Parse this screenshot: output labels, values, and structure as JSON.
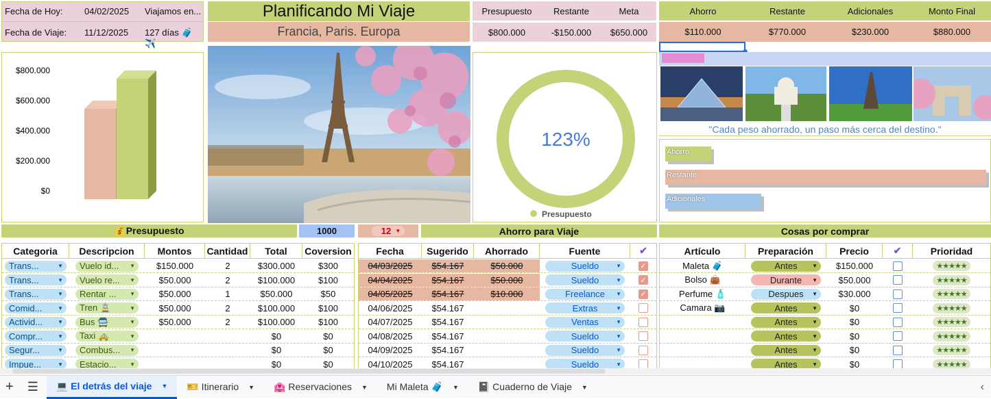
{
  "header": {
    "fecha_hoy_label": "Fecha de Hoy:",
    "fecha_hoy": "04/02/2025",
    "viajamos_label": "Viajamos en...",
    "fecha_viaje_label": "Fecha de Viaje:",
    "fecha_viaje": "11/12/2025",
    "dias": "127 días 🧳 ✈️",
    "title": "Planificando Mi Viaje",
    "destination": "Francia, Paris. Europa"
  },
  "budget_summary": {
    "headers": [
      "Presupuesto",
      "Restante",
      "Meta"
    ],
    "values": [
      "$800.000",
      "-$150.000",
      "$650.000"
    ]
  },
  "savings_summary": {
    "headers": [
      "Ahorro",
      "Restante",
      "Adicionales",
      "Monto Final"
    ],
    "values": [
      "$110.000",
      "$770.000",
      "$230.000",
      "$880.000"
    ]
  },
  "bar_chart": {
    "ticks": [
      "$800.000",
      "$600.000",
      "$400.000",
      "$200.000",
      "$0"
    ],
    "colors": {
      "a": "#e6b8a2",
      "b": "#c6d278"
    }
  },
  "chart_data": [
    {
      "type": "bar",
      "categories": [
        ""
      ],
      "series": [
        {
          "values": [
            600000
          ]
        },
        {
          "values": [
            800000
          ]
        }
      ],
      "ylim": [
        0,
        800000
      ],
      "yticks": [
        "$800.000",
        "$600.000",
        "$400.000",
        "$200.000",
        "$0"
      ],
      "grid": false
    },
    {
      "type": "pie",
      "value_label": "123%",
      "legend": "Presupuesto",
      "color": "#c6d278",
      "values": [
        100
      ]
    },
    {
      "type": "bar",
      "orientation": "horizontal",
      "categories": [
        "Ahorro",
        "Restante",
        "Adicionales"
      ],
      "values": [
        110000,
        770000,
        230000
      ],
      "colors": [
        "#c6d278",
        "#e6b8a2",
        "#9fc5e8"
      ],
      "xlim": [
        0,
        770000
      ]
    }
  ],
  "donut": {
    "percent": "123%",
    "legend": "Presupuesto",
    "color": "#c6d278"
  },
  "quote": "\"Cada peso ahorrado, un paso más cerca del destino.\"",
  "hbars": {
    "labels": [
      "Ahorro",
      "Restante",
      "Adicionales"
    ]
  },
  "section_titles": {
    "presupuesto": "💰Presupuesto",
    "presupuesto_val": "1000",
    "ahorro_count": "12",
    "ahorro": "Ahorro para Viaje",
    "cosas": "Cosas por comprar"
  },
  "budget_table": {
    "headers": [
      "Categoria",
      "Descripcion",
      "Montos",
      "Cantidad",
      "Total",
      "Coversion"
    ],
    "rows": [
      [
        "Trans...",
        "Vuelo id...",
        "$150.000",
        "2",
        "$300.000",
        "$300"
      ],
      [
        "Trans...",
        "Vuelo re...",
        "$50.000",
        "2",
        "$100.000",
        "$100"
      ],
      [
        "Trans...",
        "Rentar ...",
        "$50.000",
        "1",
        "$50.000",
        "$50"
      ],
      [
        "Comid...",
        "Tren 🚊",
        "$50.000",
        "2",
        "$100.000",
        "$100"
      ],
      [
        "Activid...",
        "Bus 🚍",
        "$50.000",
        "2",
        "$100.000",
        "$100"
      ],
      [
        "Compr...",
        "Taxi 🚕",
        "",
        "",
        "$0",
        "$0"
      ],
      [
        "Segur...",
        "Combus...",
        "",
        "",
        "$0",
        "$0"
      ],
      [
        "Impue...",
        "Estacio...",
        "",
        "",
        "$0",
        "$0"
      ]
    ]
  },
  "savings_table": {
    "headers": [
      "Fecha",
      "Sugerido",
      "Ahorrado",
      "Fuente",
      "✔"
    ],
    "rows": [
      {
        "fecha": "04/03/2025",
        "sug": "$54.167",
        "aho": "$50.000",
        "fuente": "Sueldo",
        "done": true
      },
      {
        "fecha": "04/04/2025",
        "sug": "$54.167",
        "aho": "$50.000",
        "fuente": "Sueldo",
        "done": true
      },
      {
        "fecha": "04/05/2025",
        "sug": "$54.167",
        "aho": "$10.000",
        "fuente": "Freelance",
        "done": true
      },
      {
        "fecha": "04/06/2025",
        "sug": "$54.167",
        "aho": "",
        "fuente": "Extras",
        "done": false
      },
      {
        "fecha": "04/07/2025",
        "sug": "$54.167",
        "aho": "",
        "fuente": "Ventas",
        "done": false
      },
      {
        "fecha": "04/08/2025",
        "sug": "$54.167",
        "aho": "",
        "fuente": "Sueldo",
        "done": false
      },
      {
        "fecha": "04/09/2025",
        "sug": "$54.167",
        "aho": "",
        "fuente": "Sueldo",
        "done": false
      },
      {
        "fecha": "04/10/2025",
        "sug": "$54.167",
        "aho": "",
        "fuente": "Sueldo",
        "done": false
      }
    ]
  },
  "shopping_table": {
    "headers": [
      "Artículo",
      "Preparación",
      "Precio",
      "✔",
      "Prioridad"
    ],
    "rows": [
      {
        "art": "Maleta 🧳",
        "prep": "Antes",
        "precio": "$150.000",
        "stars": "★★★★★"
      },
      {
        "art": "Bolso 👜",
        "prep": "Durante",
        "precio": "$50.000",
        "stars": "★★★★★"
      },
      {
        "art": "Perfume 🧴",
        "prep": "Despues",
        "precio": "$30.000",
        "stars": "★★★★★"
      },
      {
        "art": "Camara 📷",
        "prep": "Antes",
        "precio": "$0",
        "stars": "★★★★★"
      },
      {
        "art": "",
        "prep": "Antes",
        "precio": "$0",
        "stars": "★★★★★"
      },
      {
        "art": "",
        "prep": "Antes",
        "precio": "$0",
        "stars": "★★★★★"
      },
      {
        "art": "",
        "prep": "Antes",
        "precio": "$0",
        "stars": "★★★★★"
      },
      {
        "art": "",
        "prep": "Antes",
        "precio": "$0",
        "stars": "★★★★★"
      }
    ]
  },
  "tabs": [
    {
      "label": "💻 El detrás del viaje",
      "active": true
    },
    {
      "label": "🎫 Itinerario",
      "active": false
    },
    {
      "label": "🏩 Reservaciones",
      "active": false
    },
    {
      "label": "Mi Maleta 🧳",
      "active": false
    },
    {
      "label": "📓 Cuaderno de Viaje",
      "active": false
    }
  ]
}
